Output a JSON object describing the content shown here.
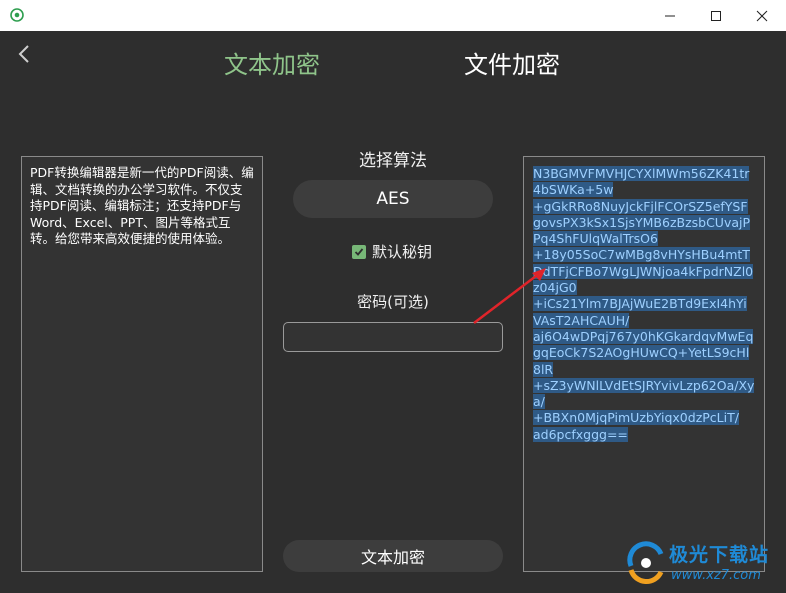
{
  "window": {
    "controls": {
      "minimize": "minimize-icon",
      "maximize": "maximize-icon",
      "close": "close-icon"
    }
  },
  "header": {
    "tabs": [
      {
        "label": "文本加密",
        "active": true,
        "color": "#8fc48a"
      },
      {
        "label": "文件加密",
        "active": false,
        "color": "#ffffff"
      }
    ]
  },
  "input_panel": {
    "text": "PDF转换编辑器是新一代的PDF阅读、编辑、文档转换的办公学习软件。不仅支持PDF阅读、编辑标注；还支持PDF与Word、Excel、PPT、图片等格式互转。给您带来高效便捷的使用体验。"
  },
  "controls": {
    "algorithm_label": "选择算法",
    "algorithm_value": "AES",
    "default_key_label": "默认秘钥",
    "default_key_checked": true,
    "password_label": "密码(可选)",
    "password_value": "",
    "encrypt_button": "文本加密"
  },
  "output_panel": {
    "lines": [
      "N3BGMVFMVHJCYXlMWm56ZK41tr4bSWKa+5w",
      "+gGkRRo8NuyJckFjlFCOrSZ5efYSFgovsPX3kSx1SjsYMB6zBzsbCUvajPPq4ShFUlqWalTrsO6",
      "+18y05SoC7wMBg8vHYsHBu4mtTDdTFjCFBo7WgLJWNjoa4kFpdrNZl0z04jG0",
      "+iCs21Ylm7BJAjWuE2BTd9ExI4hYiVAsT2AHCAUH/",
      "aj6O4wDPqj767y0hKGkardqvMwEqgqEoCk7S2AOgHUwCQ+YetLS9cHl8lR",
      "+sZ3yWNlLVdEtSJRYvivLzp62Oa/Xya/",
      "+BBXn0MjqPimUzbYiqx0dzPcLiT/",
      "ad6pcfxggg=="
    ],
    "highlight_color": "#2f5a86"
  },
  "watermark": {
    "title": "极光下载站",
    "url": "www.xz7.com"
  }
}
